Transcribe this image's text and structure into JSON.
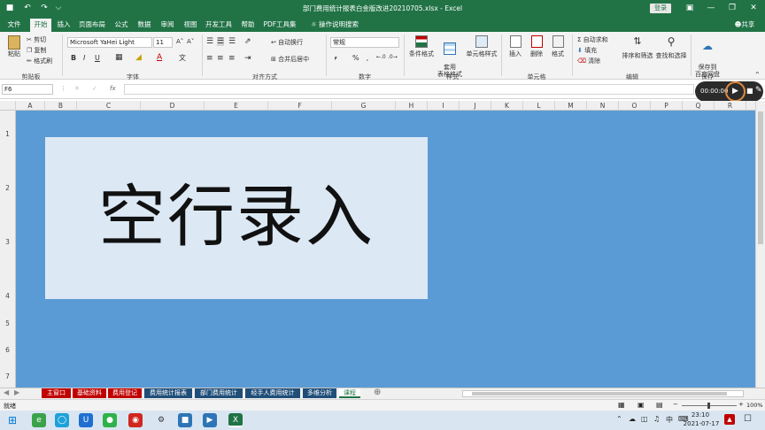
{
  "window": {
    "title": "部门费用统计报表白金版改进20210705.xlsx  -  Excel",
    "login": "登录",
    "controls": [
      "—",
      "❐",
      "✕"
    ],
    "ribbon_toggle": "▣"
  },
  "quick_access": {
    "save": "■",
    "undo": "↶",
    "redo": "↷",
    "more": "⌵"
  },
  "tabs": [
    "文件",
    "开始",
    "插入",
    "页面布局",
    "公式",
    "数据",
    "审阅",
    "视图",
    "开发工具",
    "帮助",
    "PDF工具集"
  ],
  "search_hint": "操作说明搜索",
  "share": "共享",
  "ribbon": {
    "clipboard": {
      "paste": "粘贴",
      "cut": "剪切",
      "copy": "复制",
      "format_painter": "格式刷",
      "group": "剪贴板"
    },
    "font": {
      "name": "Microsoft YaHei Light",
      "size": "11",
      "bold": "B",
      "italic": "I",
      "underline": "U",
      "grow": "A˄",
      "shrink": "A˅",
      "group": "字体"
    },
    "align": {
      "wrap": "自动换行",
      "merge": "合并后居中",
      "group": "对齐方式"
    },
    "number": {
      "format": "常规",
      "percent": "%",
      "comma": " , ",
      "group": "数字"
    },
    "styles": {
      "cond": "条件格式",
      "table": "套用\n表格格式",
      "cell": "单元格样式",
      "group": "样式"
    },
    "cells": {
      "insert": "插入",
      "delete": "删除",
      "format": "格式",
      "group": "单元格"
    },
    "editing": {
      "autosum": "自动求和",
      "fill": "填充",
      "clear": "清除",
      "sort": "排序和筛选",
      "find": "查找和选择",
      "group": "编辑"
    },
    "save": {
      "label": "保存到\n百度网盘",
      "group": "保存"
    }
  },
  "formula_bar": {
    "cell_ref": "F6",
    "fx": "fx",
    "cancel": "✕",
    "confirm": "✓",
    "value": ""
  },
  "columns": [
    "A",
    "B",
    "C",
    "D",
    "E",
    "F",
    "G",
    "H",
    "I",
    "J",
    "K",
    "L",
    "M",
    "N",
    "O",
    "P",
    "Q",
    "R"
  ],
  "rows": [
    "1",
    "2",
    "3",
    "4",
    "5",
    "6",
    "7"
  ],
  "content": {
    "big_text": "空行录入"
  },
  "sheet_tabs": [
    {
      "label": "主窗口",
      "color": "#c00000"
    },
    {
      "label": "基础资料",
      "color": "#c00000"
    },
    {
      "label": "费用登记",
      "color": "#c00000"
    },
    {
      "label": "费用统计报表",
      "color": "#1f4e79"
    },
    {
      "label": "部门费用统计",
      "color": "#1f4e79"
    },
    {
      "label": "经手人费用统计",
      "color": "#1f4e79"
    },
    {
      "label": "多维分析",
      "color": "#1f4e79"
    },
    {
      "label": "课程",
      "color": "#ffffff"
    }
  ],
  "add_sheet": "⊕",
  "status": {
    "ready": "就绪",
    "zoom": "100%",
    "minus": "−",
    "plus": "+"
  },
  "recorder": {
    "time": "00:00:00",
    "play": "▶",
    "stop": "■",
    "pen": "✎"
  },
  "taskbar": {
    "time": "23:10",
    "date": "2021-07-17",
    "ime": "中",
    "start": "⊞"
  },
  "colors": {
    "accent": "#217346",
    "sheet_bg": "#5b9bd5",
    "card": "#dce9f5"
  }
}
